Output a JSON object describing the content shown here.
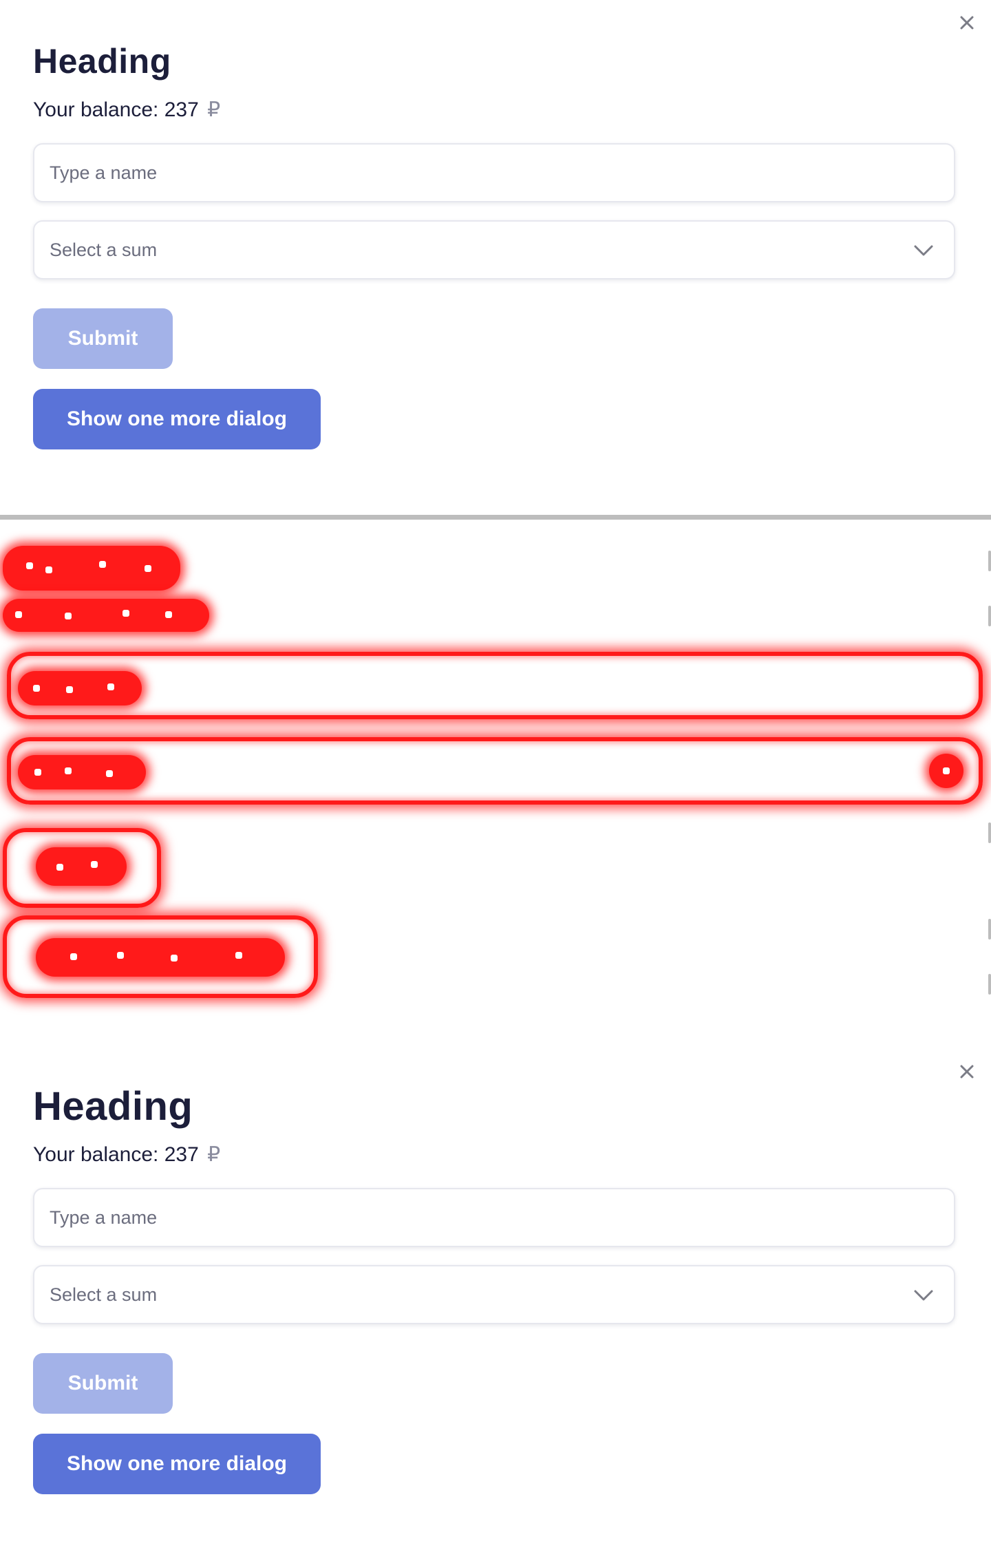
{
  "dialogs": [
    {
      "heading": "Heading",
      "balance": "Your balance: 237",
      "currency_symbol": "₽",
      "name_input": {
        "placeholder": "Type a name",
        "value": ""
      },
      "sum_select": {
        "placeholder": "Select a sum"
      },
      "submit_label": "Submit",
      "more_label": "Show one more dialog"
    },
    {
      "heading": "Heading",
      "balance": "Your balance: 237",
      "currency_symbol": "₽",
      "name_input": {
        "placeholder": "Type a name",
        "value": ""
      },
      "sum_select": {
        "placeholder": "Select a sum"
      },
      "submit_label": "Submit",
      "more_label": "Show one more dialog"
    }
  ],
  "icons": {
    "close": "close-icon",
    "chevron": "chevron-down-icon"
  },
  "colors": {
    "heading": "#1c1e3a",
    "submit_disabled": "#a3b2e8",
    "primary": "#5a73d8",
    "field_border": "#e6e7ee",
    "highlight": "#ff1a1a"
  }
}
